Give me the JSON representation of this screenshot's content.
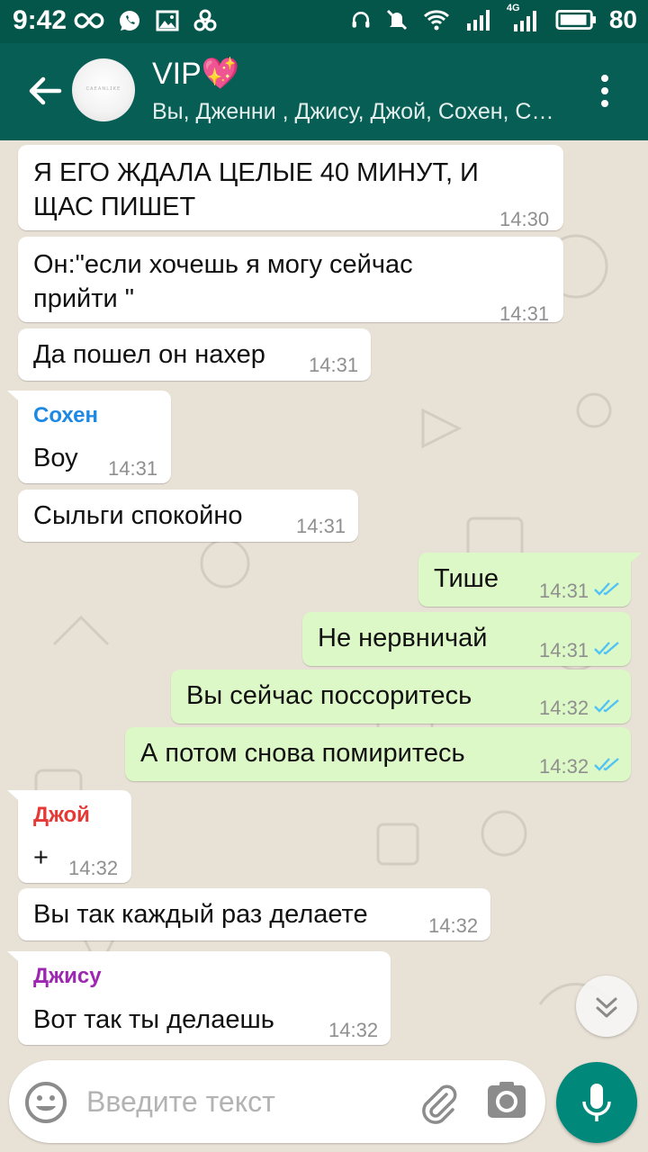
{
  "status_bar": {
    "time": "9:42",
    "battery_level": "80",
    "network_badge": "4G",
    "icons_left": [
      "infinity-icon",
      "whatsapp-icon",
      "gallery-icon",
      "sync-icon"
    ],
    "icons_right": [
      "headset-icon",
      "mute-icon",
      "wifi-icon",
      "signal-icon",
      "signal-4g-icon",
      "battery-icon"
    ]
  },
  "header": {
    "title": "VIP💖",
    "members": "Вы, Дженни , Джису, Джой, Сохен, С…",
    "avatar_text": "ᴄᴀᴇᴀɴʟɪᴋᴇ",
    "colors": {
      "bar": "#075e54",
      "status": "#05564a"
    }
  },
  "messages": [
    {
      "dir": "in",
      "sender": "",
      "lines": [
        "Я ЕГО ЖДАЛА ЦЕЛЫЕ 40 МИНУТ, И",
        "ЩАС ПИШЕТ"
      ],
      "time": "14:30"
    },
    {
      "dir": "in",
      "sender": "",
      "lines": [
        "Он:\"если хочешь я могу сейчас",
        "прийти \""
      ],
      "time": "14:31"
    },
    {
      "dir": "in",
      "sender": "",
      "lines": [
        "Да пошел он нахер"
      ],
      "time": "14:31"
    },
    {
      "dir": "in",
      "sender": "Сохен",
      "sender_color": "#1e88e5",
      "lines": [
        "Воу"
      ],
      "time": "14:31"
    },
    {
      "dir": "in",
      "sender": "",
      "lines": [
        "Сыльги спокойно"
      ],
      "time": "14:31"
    },
    {
      "dir": "out",
      "sender": "",
      "lines": [
        "Тише"
      ],
      "time": "14:31",
      "read": true
    },
    {
      "dir": "out",
      "sender": "",
      "lines": [
        "Не нервничай"
      ],
      "time": "14:31",
      "read": true
    },
    {
      "dir": "out",
      "sender": "",
      "lines": [
        "Вы сейчас поссоритесь"
      ],
      "time": "14:32",
      "read": true
    },
    {
      "dir": "out",
      "sender": "",
      "lines": [
        "А потом снова помиритесь"
      ],
      "time": "14:32",
      "read": true
    },
    {
      "dir": "in",
      "sender": "Джой",
      "sender_color": "#e53935",
      "lines": [
        "+"
      ],
      "time": "14:32"
    },
    {
      "dir": "in",
      "sender": "",
      "lines": [
        "Вы так каждый раз делаете"
      ],
      "time": "14:32"
    },
    {
      "dir": "in",
      "sender": "Джису",
      "sender_color": "#9c27b0",
      "lines": [
        "Вот так ты делаешь"
      ],
      "time": "14:32"
    }
  ],
  "composer": {
    "placeholder": "Введите текст"
  },
  "colors": {
    "incoming": "#ffffff",
    "outgoing": "#dcf8c6",
    "read_ticks": "#4fc3f7",
    "mic": "#00897b"
  }
}
